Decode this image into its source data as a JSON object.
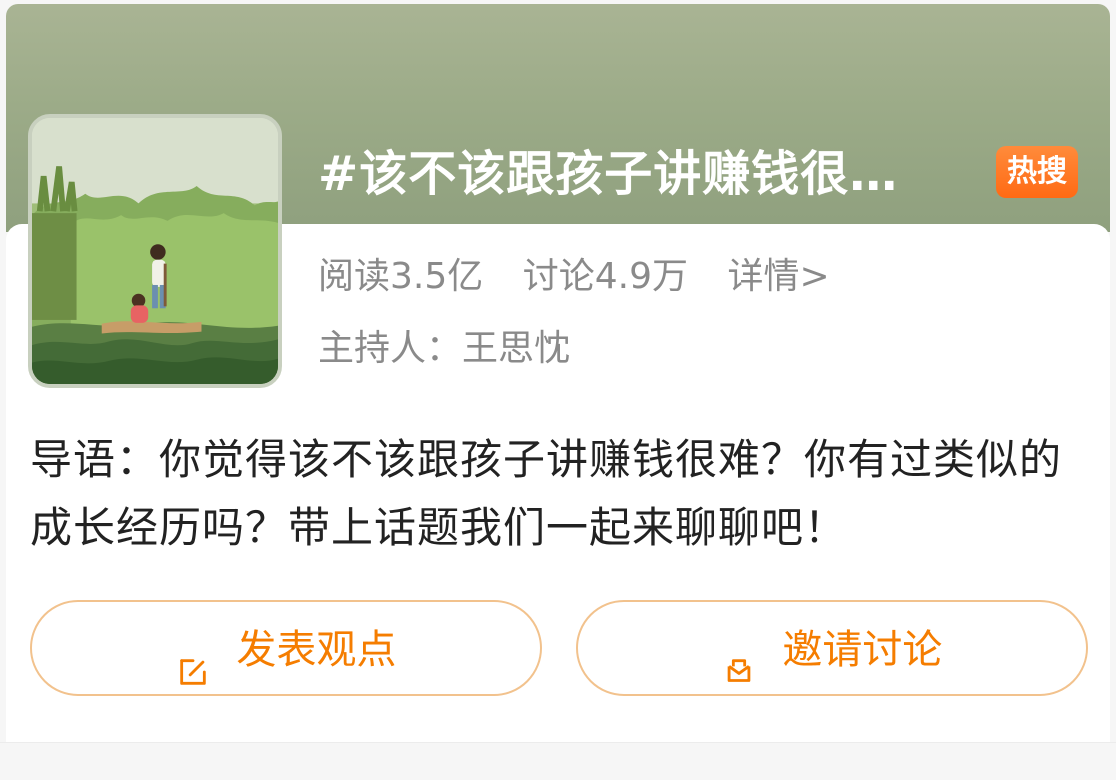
{
  "topic": {
    "title": "#该不该跟孩子讲赚钱很…",
    "badge": "热搜",
    "stats": {
      "read": "阅读3.5亿",
      "discuss": "讨论4.9万",
      "detail": "详情>"
    },
    "host": "主持人：王思忱",
    "intro": "导语：你觉得该不该跟孩子讲赚钱很难？你有过类似的成长经历吗？带上话题我们一起来聊聊吧！"
  },
  "actions": {
    "post_label": "发表观点",
    "invite_label": "邀请讨论"
  },
  "icons": {
    "post": "edit-icon",
    "invite": "mail-icon"
  },
  "colors": {
    "accent": "#f57d00",
    "badge": "#ff6a14",
    "meta": "#8a8a8a",
    "text": "#222222"
  }
}
